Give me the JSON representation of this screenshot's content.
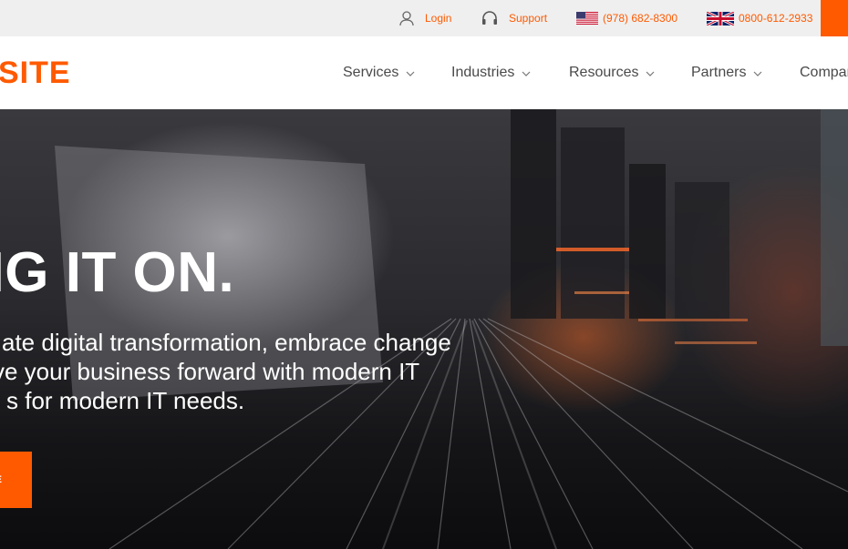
{
  "topbar": {
    "login_label": "Login",
    "support_label": "Support",
    "phone_us": "(978) 682-8300",
    "phone_uk": "0800-612-2933",
    "accent_color": "#ff5a00"
  },
  "header": {
    "logo_text": "SITE",
    "nav": [
      {
        "label": "Services"
      },
      {
        "label": "Industries"
      },
      {
        "label": "Resources"
      },
      {
        "label": "Partners"
      },
      {
        "label": "Compar"
      }
    ]
  },
  "hero": {
    "title": "NG IT ON.",
    "subtitle_lines": [
      "ate digital transformation, embrace change",
      "ve your business forward with modern IT",
      "s for modern IT needs."
    ],
    "cta_label": "E"
  }
}
